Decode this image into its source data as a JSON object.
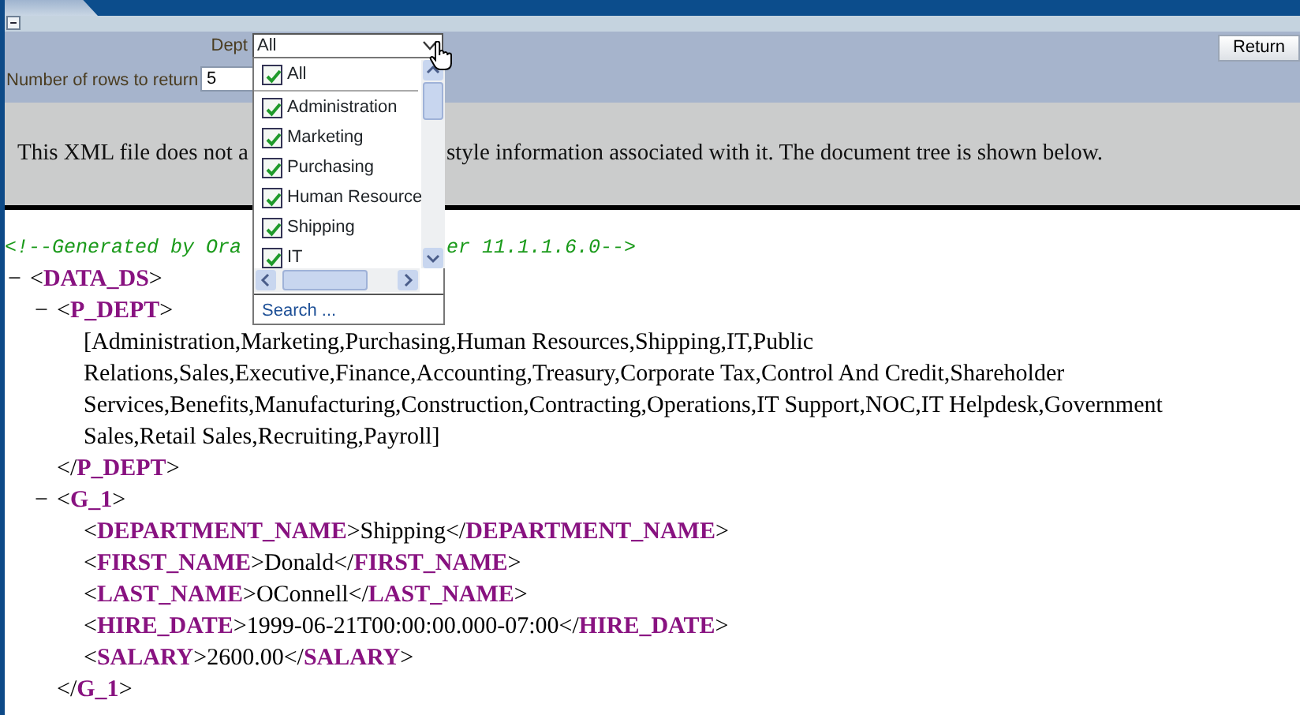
{
  "params": {
    "dept_label": "Dept",
    "dept_value": "All",
    "rows_label": "Number of rows to return",
    "rows_value": "5",
    "return_button": "Return"
  },
  "dept_dropdown": {
    "expanded": true,
    "items": [
      {
        "label": "All",
        "checked": true
      },
      {
        "label": "Administration",
        "checked": true
      },
      {
        "label": "Marketing",
        "checked": true
      },
      {
        "label": "Purchasing",
        "checked": true
      },
      {
        "label": "Human Resource",
        "checked": true
      },
      {
        "label": "Shipping",
        "checked": true
      },
      {
        "label": "IT",
        "checked": true
      }
    ],
    "search_link": "Search ..."
  },
  "message": {
    "before": "This XML file does not a",
    "after": "style information associated with it. The document tree is shown below."
  },
  "xml": {
    "comment_before": "<!--Generated by Ora",
    "comment_after": "er 11.1.1.6.0-->",
    "root": {
      "toggle": "−",
      "open": "<**DATA_DS**>",
      "children": [
        {
          "toggle": "−",
          "open": "<**P_DEPT**>",
          "children": [
            {
              "text": "[Administration,Marketing,Purchasing,Human Resources,Shipping,IT,Public Relations,Sales,Executive,Finance,Accounting,Treasury,Corporate Tax,Control And Credit,Shareholder Services,Benefits,Manufacturing,Construction,Contracting,Operations,IT Support,NOC,IT Helpdesk,Government Sales,Retail Sales,Recruiting,Payroll]"
            }
          ],
          "close": "</**P_DEPT**>"
        },
        {
          "toggle": "−",
          "open": "<**G_1**>",
          "children": [
            {
              "line": "<**DEPARTMENT_NAME**>Shipping</**DEPARTMENT_NAME**>"
            },
            {
              "line": "<**FIRST_NAME**>Donald</**FIRST_NAME**>"
            },
            {
              "line": "<**LAST_NAME**>OConnell</**LAST_NAME**>"
            },
            {
              "line": "<**HIRE_DATE**>1999-06-21T00:00:00.000-07:00</**HIRE_DATE**>"
            },
            {
              "line": "<**SALARY**>2600.00</**SALARY**>"
            }
          ],
          "close": "</**G_1**>"
        }
      ]
    }
  }
}
